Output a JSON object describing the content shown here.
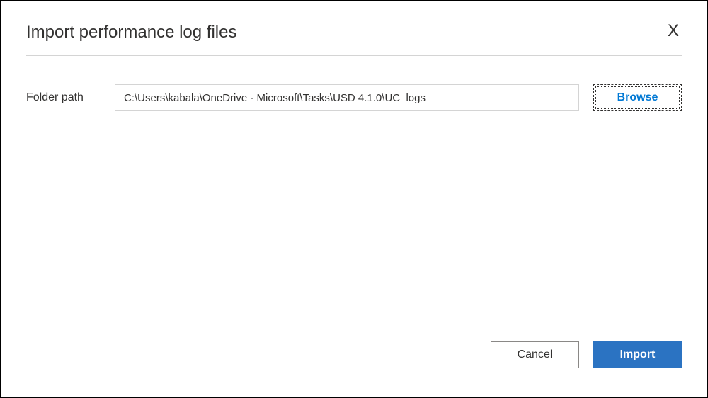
{
  "dialog": {
    "title": "Import performance log files",
    "close_label": "X"
  },
  "form": {
    "folder_path_label": "Folder path",
    "folder_path_value": "C:\\Users\\kabala\\OneDrive - Microsoft\\Tasks\\USD 4.1.0\\UC_logs",
    "browse_label": "Browse"
  },
  "footer": {
    "cancel_label": "Cancel",
    "import_label": "Import"
  },
  "colors": {
    "primary": "#2b73c2",
    "link": "#0078d4",
    "text": "#323130",
    "border": "#d4d4d4"
  }
}
